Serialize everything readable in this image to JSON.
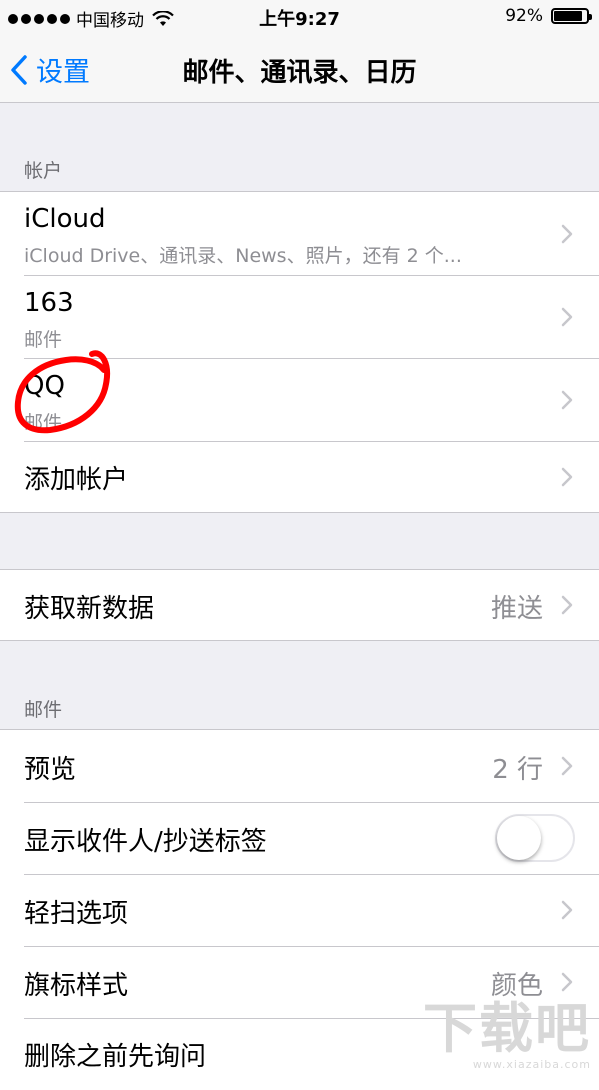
{
  "status_bar": {
    "carrier": "中国移动",
    "time": "上午9:27",
    "battery": "92%",
    "battery_level": 0.92,
    "icons": [
      "signal-dots-icon",
      "wifi-icon",
      "battery-icon"
    ]
  },
  "nav": {
    "back_label": "设置",
    "title": "邮件、通讯录、日历"
  },
  "accounts": {
    "header": "帐户",
    "items": [
      {
        "title": "iCloud",
        "subtitle": "iCloud Drive、通讯录、News、照片，还有 2 个..."
      },
      {
        "title": "163",
        "subtitle": "邮件"
      },
      {
        "title": "QQ",
        "subtitle": "邮件"
      }
    ],
    "add_account": "添加帐户"
  },
  "fetch": {
    "label": "获取新数据",
    "value": "推送"
  },
  "mail": {
    "header": "邮件",
    "preview": {
      "label": "预览",
      "value": "2 行"
    },
    "show_to_cc": {
      "label": "显示收件人/抄送标签",
      "on": false
    },
    "swipe_options": {
      "label": "轻扫选项"
    },
    "flag_style": {
      "label": "旗标样式",
      "value": "颜色"
    },
    "ask_before_delete": {
      "label": "删除之前先询问"
    }
  },
  "watermark": {
    "text": "下载吧",
    "url": "www.xiazaiba.com"
  },
  "colors": {
    "accent": "#007aff",
    "background": "#efeff4",
    "secondary_text": "#8e8e93",
    "annotation": "#ff0000"
  }
}
